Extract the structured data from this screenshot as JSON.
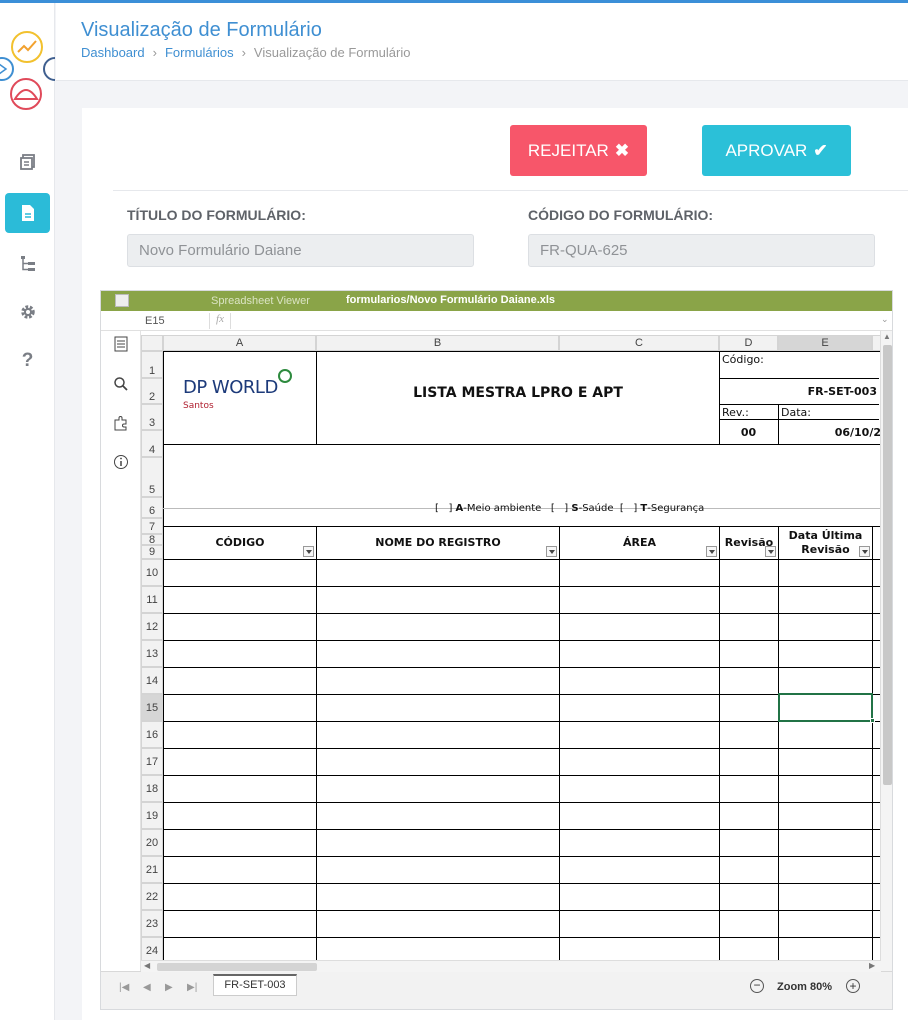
{
  "header": {
    "title": "Visualização de Formulário",
    "breadcrumb": [
      "Dashboard",
      "Formulários",
      "Visualização de Formulário"
    ]
  },
  "sidebar": {
    "items": [
      {
        "icon": "book-icon",
        "active": false
      },
      {
        "icon": "document-icon",
        "active": true
      },
      {
        "icon": "tree-icon",
        "active": false
      },
      {
        "icon": "gear-icon",
        "active": false
      },
      {
        "icon": "help-icon",
        "active": false
      }
    ]
  },
  "actions": {
    "reject_label": "REJEITAR",
    "approve_label": "APROVAR"
  },
  "form": {
    "title_label": "TÍTULO DO FORMULÁRIO:",
    "title_value": "Novo Formulário Daiane",
    "code_label": "CÓDIGO DO FORMULÁRIO:",
    "code_value": "FR-QUA-625"
  },
  "viewer": {
    "app_name": "Spreadsheet Viewer",
    "file_path": "formularios/Novo Formulário Daiane.xls",
    "cell_ref": "E15",
    "fx": "fx",
    "sheet_tab": "FR-SET-003",
    "zoom": "Zoom 80%",
    "columns": [
      "A",
      "B",
      "C",
      "D",
      "E"
    ],
    "selected_column": "E",
    "rows": [
      "1",
      "2",
      "3",
      "4",
      "5",
      "6",
      "7",
      "8",
      "9",
      "10",
      "11",
      "12",
      "13",
      "14",
      "15",
      "16",
      "17",
      "18",
      "19",
      "20",
      "21",
      "22",
      "23",
      "24"
    ],
    "selected_row": "15"
  },
  "sheet": {
    "company": "DP WORLD",
    "company_sub": "Santos",
    "doc_title": "LISTA MESTRA LPRO E APT",
    "codigo_label": "Código:",
    "codigo_value": "FR-SET-003",
    "rev_label": "Rev.:",
    "rev_value": "00",
    "data_label": "Data:",
    "data_value": "06/10/2",
    "legend": {
      "a_key": "A",
      "a_text": "-Meio ambiente",
      "s_key": "S",
      "s_text": "-Saúde",
      "t_key": "T",
      "t_text": "-Segurança",
      "bracket": "[   ]"
    },
    "headers": [
      "CÓDIGO",
      "NOME DO REGISTRO",
      "ÁREA",
      "Revisão",
      "Data Última Revisão"
    ]
  },
  "colors": {
    "accent": "#3f8fd2",
    "reject": "#f7566a",
    "approve": "#2bc0d8",
    "viewer_bar": "#8aa448"
  }
}
